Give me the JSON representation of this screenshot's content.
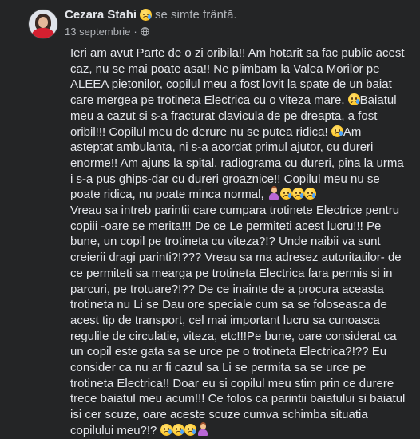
{
  "post": {
    "author": "Cezara Stahi",
    "feeling": "se simte frântă.",
    "feeling_emoji": "crying-face",
    "date": "13 septembrie",
    "separator": "·",
    "audience_icon": "globe-icon",
    "text_blocks": [
      "Ieri am avut Parte de o zi oribila!! Am hotarit sa fac public acest caz, nu se mai poate asa!! Ne plimbam la Valea Morilor pe ALEEA pietonilor, copilul meu a fost lovit la spate de un baiat care mergea pe trotineta Electrica cu o viteza mare.",
      "Baiatul meu a cazut si s-a fracturat clavicula de pe dreapta, a fost oribil!!! Copilul meu de derure nu se putea ridica!",
      "Am asteptat ambulanta, ni s-a acordat primul ajutor, cu dureri enorme!! Am ajuns la spital, radiograma cu dureri, pina la urma i s-a pus ghips-dar cu dureri groaznice!! Copilul meu nu se poate ridica, nu poate minca normal,",
      "Vreau sa intreb parintii care cumpara trotinete Electrice pentru copiii -oare se merita!!! De ce Le permiteti acest lucru!!! Pe bune, un copil pe trotineta cu viteza?!? Unde naibii va sunt creierii dragi parinti?!??? Vreau sa ma adresez autoritatilor- de ce permiteti  sa mearga pe trotineta Electrica fara permis si in parcuri, pe trotuare?!?? De ce inainte de a procura aceasta trotineta nu Li se Dau ore speciale cum sa se foloseasca de acest tip de transport, cel mai important lucru sa cunoasca regulile de circulatie, viteza, etc!!!Pe bune, oare considerat ca un copil este gata sa se urce pe o trotineta Electrica?!?? Eu consider ca nu ar fi cazul sa Li se permita sa se urce pe trotineta Electrica!! Doar eu si copilul meu stim prin ce durere trece baiatul meu acum!!! Ce folos ca parintii baiatului si baiatul  isi cer scuze, oare aceste scuze cumva schimba situatia copilului meu?!?"
    ],
    "colors": {
      "background": "#242526",
      "text_primary": "#e4e6eb",
      "text_secondary": "#b0b3b8",
      "emoji_yellow": "#ffcc33",
      "tear_blue": "#4aa3ff"
    }
  }
}
